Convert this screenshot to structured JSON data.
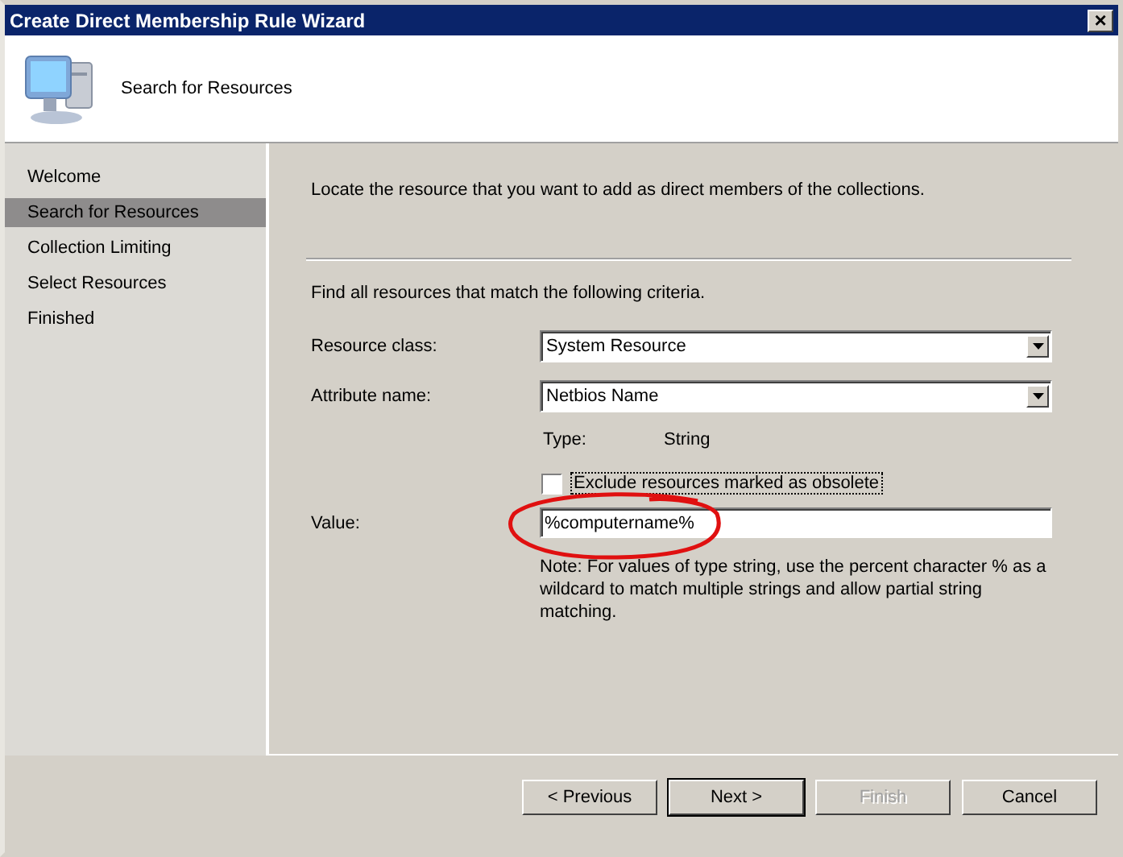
{
  "window": {
    "title": "Create Direct Membership Rule Wizard",
    "close": "×"
  },
  "header": {
    "title": "Search for Resources"
  },
  "steps": [
    {
      "label": "Welcome",
      "selected": false
    },
    {
      "label": "Search for Resources",
      "selected": true
    },
    {
      "label": "Collection Limiting",
      "selected": false
    },
    {
      "label": "Select Resources",
      "selected": false
    },
    {
      "label": "Finished",
      "selected": false
    }
  ],
  "intro": "Locate the resource that you want to add as direct members of the collections.",
  "criteria_label": "Find all resources that match the following criteria.",
  "resource_class": {
    "label": "Resource class:",
    "value": "System Resource"
  },
  "attribute_name": {
    "label": "Attribute name:",
    "value": "Netbios Name"
  },
  "type": {
    "label": "Type:",
    "value": "String"
  },
  "exclude_obsolete": {
    "label": "Exclude resources marked as obsolete",
    "checked": false
  },
  "value": {
    "label": "Value:",
    "value": "%computername%"
  },
  "note": "Note: For values of type string, use the percent character % as a wildcard to match multiple strings and allow partial string matching.",
  "buttons": [
    {
      "label": "< Previous",
      "disabled": false,
      "default": false
    },
    {
      "label": "Next >",
      "disabled": false,
      "default": true
    },
    {
      "label": "Finish",
      "disabled": true,
      "default": false
    },
    {
      "label": "Cancel",
      "disabled": false,
      "default": false
    }
  ]
}
